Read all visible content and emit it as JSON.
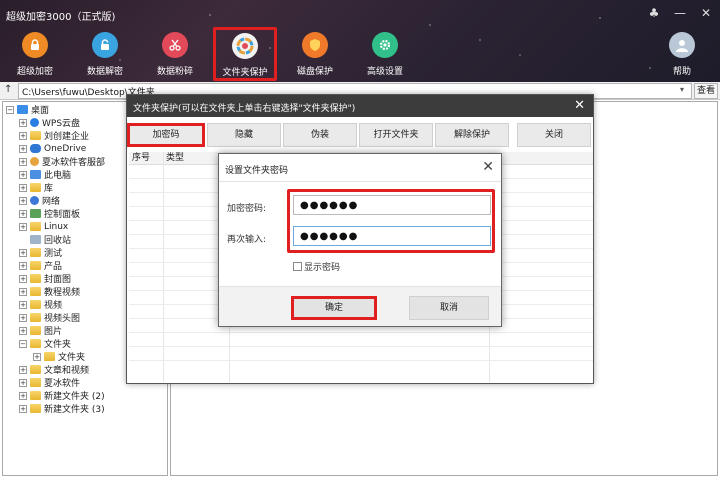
{
  "app": {
    "title": "超级加密3000（正式版)"
  },
  "window_controls": {
    "skin": "♣",
    "minimize": "—",
    "close": "✕"
  },
  "toolbar": {
    "items": [
      {
        "label": "超级加密",
        "icon": "lock-icon",
        "color": "#f08a24"
      },
      {
        "label": "数据解密",
        "icon": "unlock-icon",
        "color": "#3aa4e0"
      },
      {
        "label": "数据粉碎",
        "icon": "scissors-icon",
        "color": "#e24a5a"
      },
      {
        "label": "文件夹保护",
        "icon": "folder-protect-icon",
        "color": "#f2f2f2"
      },
      {
        "label": "磁盘保护",
        "icon": "shield-icon",
        "color": "#f07a2a"
      },
      {
        "label": "高级设置",
        "icon": "gear-icon",
        "color": "#32c08a"
      },
      {
        "label": "帮助",
        "icon": "user-help-icon",
        "color": "#b9c7d6"
      }
    ]
  },
  "address": {
    "up": "↑",
    "path": "C:\\Users\\fuwu\\Desktop\\文件夹",
    "view_label": "查看"
  },
  "tree": {
    "items": [
      {
        "label": "桌面",
        "expander": "−"
      },
      {
        "label": "WPS云盘",
        "expander": "+"
      },
      {
        "label": "刘创建企业",
        "expander": "+"
      },
      {
        "label": "OneDrive",
        "expander": "+"
      },
      {
        "label": "夏冰软件客服部",
        "expander": "+"
      },
      {
        "label": "此电脑",
        "expander": "+"
      },
      {
        "label": "库",
        "expander": "+"
      },
      {
        "label": "网络",
        "expander": "+"
      },
      {
        "label": "控制面板",
        "expander": "+"
      },
      {
        "label": "Linux",
        "expander": "+"
      },
      {
        "label": "回收站",
        "expander": ""
      },
      {
        "label": "测试",
        "expander": "+"
      },
      {
        "label": "产品",
        "expander": "+"
      },
      {
        "label": "封面图",
        "expander": "+"
      },
      {
        "label": "教程视频",
        "expander": "+"
      },
      {
        "label": "视频",
        "expander": "+"
      },
      {
        "label": "视频头图",
        "expander": "+"
      },
      {
        "label": "图片",
        "expander": "+"
      },
      {
        "label": "文件夹",
        "expander": "−"
      },
      {
        "label": "文件夹",
        "expander": "+"
      },
      {
        "label": "文章和视频",
        "expander": "+"
      },
      {
        "label": "夏冰软件",
        "expander": "+"
      },
      {
        "label": "新建文件夹 (2)",
        "expander": "+"
      },
      {
        "label": "新建文件夹 (3)",
        "expander": "+"
      }
    ]
  },
  "folder_dialog": {
    "title": "文件夹保护(可以在文件夹上单击右键选择\"文件夹保护\")",
    "close": "✕",
    "buttons": [
      "加密码",
      "隐藏",
      "伪装",
      "打开文件夹",
      "解除保护",
      "关闭"
    ],
    "columns": [
      "序号",
      "类型"
    ]
  },
  "password_dialog": {
    "title": "设置文件夹密码",
    "close": "✕",
    "password_label": "加密密码:",
    "password_value": "●●●●●●",
    "confirm_label": "再次输入:",
    "confirm_value": "●●●●●●",
    "show_password_label": "显示密码",
    "ok_label": "确定",
    "cancel_label": "取消"
  }
}
